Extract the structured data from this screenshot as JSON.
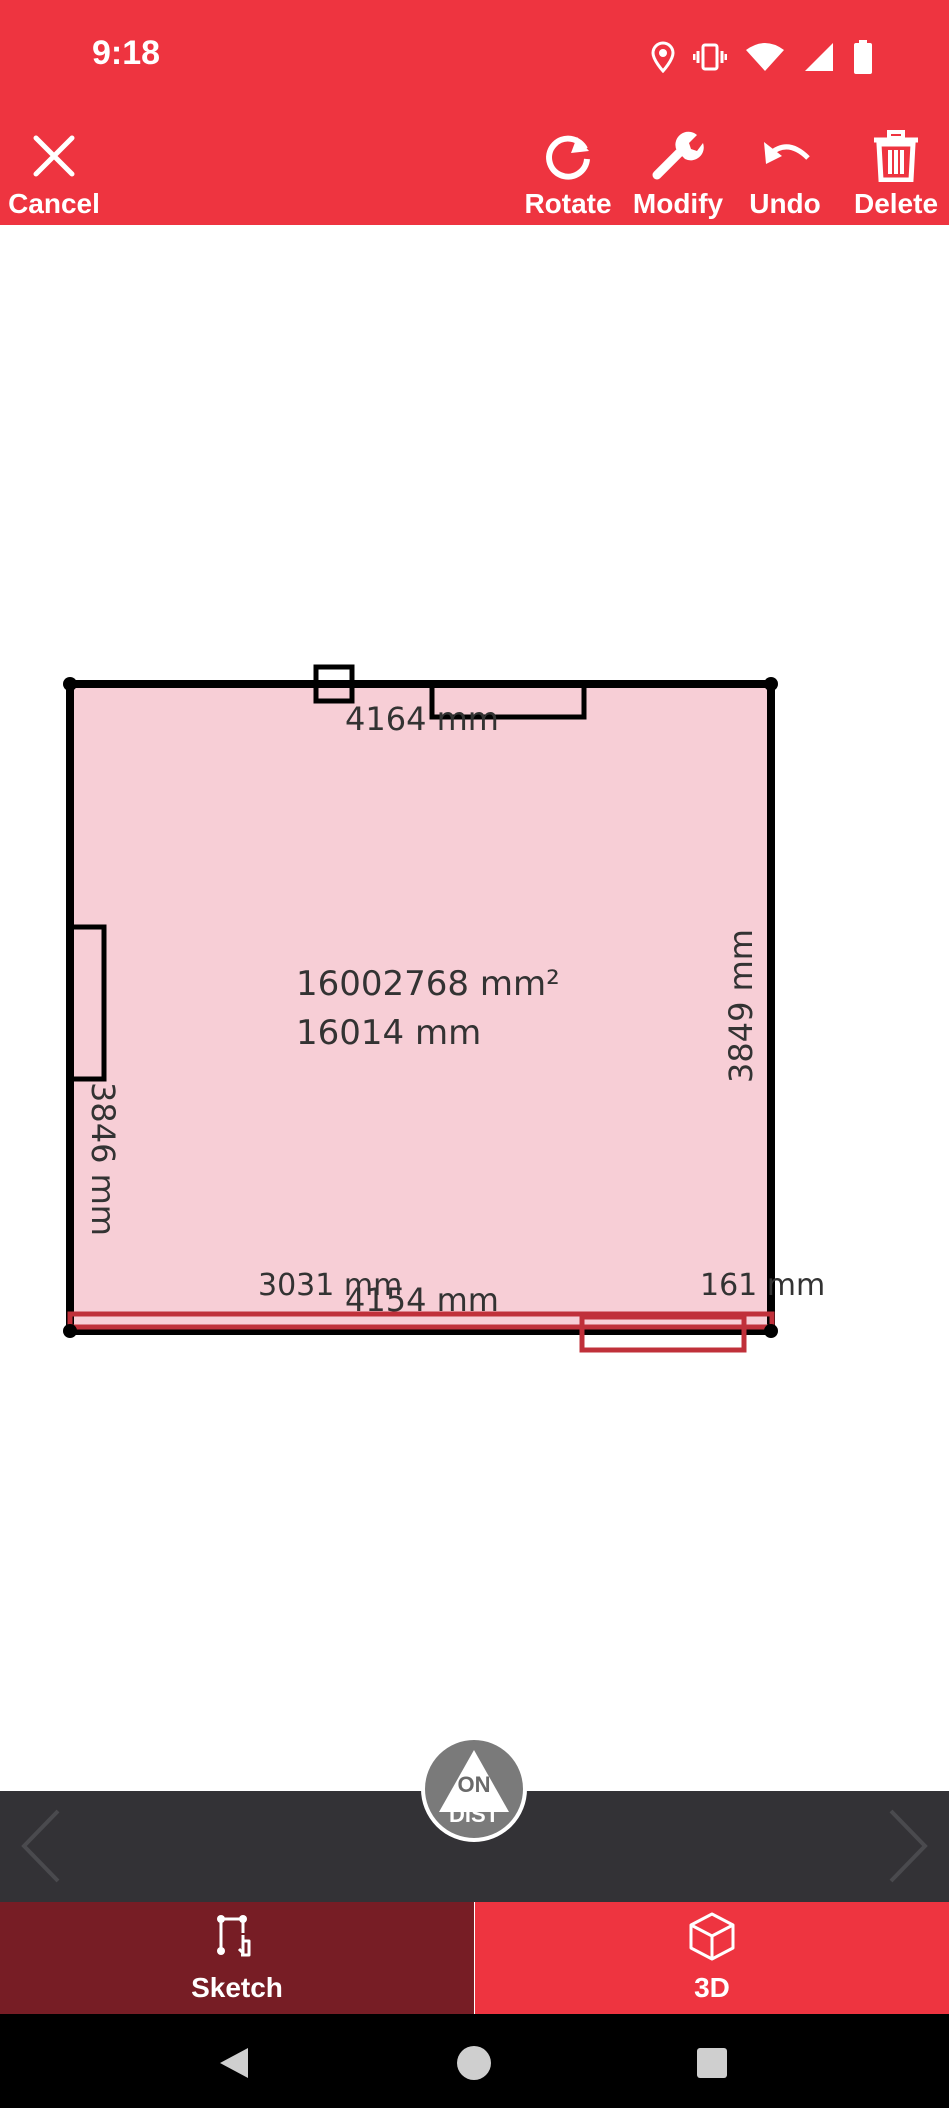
{
  "status": {
    "time": "9:18"
  },
  "toolbar": {
    "cancel_label": "Cancel",
    "rotate_label": "Rotate",
    "modify_label": "Modify",
    "undo_label": "Undo",
    "delete_label": "Delete"
  },
  "room": {
    "top_wall": "4164 mm",
    "left_wall": "3846 mm",
    "right_wall": "3849 mm",
    "bottom_wall": "4154 mm",
    "bottom_segment_left": "3031 mm",
    "bottom_segment_right": "161 mm",
    "area": "16002768 mm²",
    "perimeter": "16014 mm"
  },
  "fab": {
    "line1": "ON",
    "line2": "DIST"
  },
  "tabs": [
    {
      "label": "Sketch",
      "icon": "sketch-icon",
      "active": true
    },
    {
      "label": "3D",
      "icon": "cube-icon",
      "active": false
    }
  ],
  "colors": {
    "brand": "#ee3440",
    "tab_active": "#771d25",
    "room_fill": "#f7ced6",
    "selected_wall": "#c0303a",
    "nav_strip": "#333236"
  }
}
